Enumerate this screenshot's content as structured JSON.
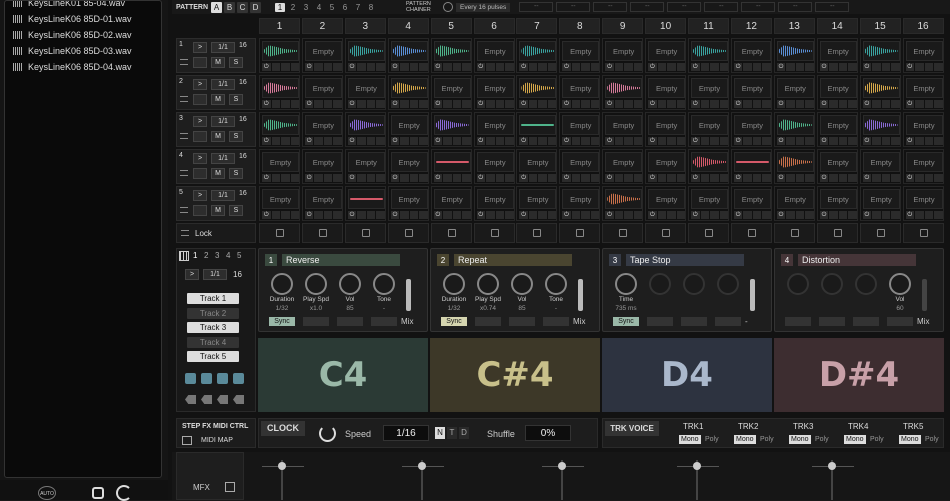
{
  "files": [
    "KeysLineK01 85-04.wav",
    "KeysLineK06 85D-01.wav",
    "KeysLineK06 85D-02.wav",
    "KeysLineK06 85D-03.wav",
    "KeysLineK06 85D-04.wav"
  ],
  "topbar": {
    "pattern_label": "PATTERN",
    "patterns": [
      "A",
      "B",
      "C",
      "D"
    ],
    "numbers": [
      "1",
      "2",
      "3",
      "4",
      "5",
      "6",
      "7",
      "8"
    ],
    "chainer_label": "PATTERN CHAINER",
    "pulses": "Every 16 pulses",
    "dash": "--"
  },
  "columns": [
    "1",
    "2",
    "3",
    "4",
    "5",
    "6",
    "7",
    "8",
    "9",
    "10",
    "11",
    "12",
    "13",
    "14",
    "15",
    "16"
  ],
  "tracks": [
    {
      "num": "1",
      "ratio": "1/1",
      "steps": "16",
      "cells": [
        "green",
        "Empty",
        "teal",
        "blue",
        "green",
        "Empty",
        "teal",
        "Empty",
        "Empty",
        "Empty",
        "teal",
        "Empty",
        "blue",
        "Empty",
        "teal",
        "Empty"
      ]
    },
    {
      "num": "2",
      "ratio": "1/1",
      "steps": "16",
      "cells": [
        "pink",
        "Empty",
        "Empty",
        "gold",
        "Empty",
        "Empty",
        "gold",
        "Empty",
        "pink",
        "Empty",
        "Empty",
        "Empty",
        "Empty",
        "Empty",
        "gold",
        "Empty"
      ]
    },
    {
      "num": "3",
      "ratio": "1/1",
      "steps": "16",
      "cells": [
        "green",
        "Empty",
        "purple",
        "Empty",
        "purple",
        "Empty",
        "gline",
        "Empty",
        "Empty",
        "Empty",
        "Empty",
        "Empty",
        "green",
        "Empty",
        "purple",
        "Empty"
      ]
    },
    {
      "num": "4",
      "ratio": "1/1",
      "steps": "16",
      "cells": [
        "Empty",
        "Empty",
        "Empty",
        "Empty",
        "rline",
        "Empty",
        "Empty",
        "Empty",
        "Empty",
        "Empty",
        "red",
        "rline",
        "orange",
        "Empty",
        "Empty",
        "Empty"
      ]
    },
    {
      "num": "5",
      "ratio": "1/1",
      "steps": "16",
      "cells": [
        "Empty",
        "Empty",
        "rline",
        "Empty",
        "Empty",
        "Empty",
        "Empty",
        "Empty",
        "orange",
        "Empty",
        "Empty",
        "Empty",
        "Empty",
        "Empty",
        "Empty",
        "Empty"
      ]
    }
  ],
  "track_buttons": {
    "m": "M",
    "s": "S",
    "play": ">"
  },
  "empty_label": "Empty",
  "lock_label": "Lock",
  "left_panel": {
    "tabs": [
      "1",
      "2",
      "3",
      "4",
      "5"
    ],
    "ratio": "1/1",
    "steps": "16",
    "tracks": [
      "Track 1",
      "Track 2",
      "Track 3",
      "Track 4",
      "Track 5"
    ],
    "midi_title": "STEP FX MIDI CTRL",
    "midi_map": "MIDI MAP"
  },
  "fx": [
    {
      "num": "1",
      "name": "Reverse",
      "color": "#3a4a3f",
      "knobs": [
        {
          "label": "Duration",
          "val": "1/32"
        },
        {
          "label": "Play Spd",
          "val": "x1.0"
        },
        {
          "label": "Vol",
          "val": "85"
        },
        {
          "label": "Tone",
          "val": "-"
        }
      ],
      "sync": "Sync",
      "mix": "Mix"
    },
    {
      "num": "2",
      "name": "Repeat",
      "color": "#4a4530",
      "knobs": [
        {
          "label": "Duration",
          "val": "1/32"
        },
        {
          "label": "Play Spd",
          "val": "x0.74"
        },
        {
          "label": "Vol",
          "val": "85"
        },
        {
          "label": "Tone",
          "val": "-"
        }
      ],
      "sync": "Sync",
      "mix": "Mix"
    },
    {
      "num": "3",
      "name": "Tape Stop",
      "color": "#353a45",
      "knobs": [
        {
          "label": "Time",
          "val": "735 ms"
        },
        {
          "label": "",
          "val": ""
        },
        {
          "label": "",
          "val": ""
        },
        {
          "label": "",
          "val": ""
        }
      ],
      "sync": "Sync",
      "mix": "-"
    },
    {
      "num": "4",
      "name": "Distortion",
      "color": "#453538",
      "knobs": [
        {
          "label": "",
          "val": ""
        },
        {
          "label": "",
          "val": ""
        },
        {
          "label": "",
          "val": ""
        },
        {
          "label": "Vol",
          "val": "60"
        }
      ],
      "sync": "",
      "mix": "Mix"
    }
  ],
  "pads": [
    "C4",
    "C#4",
    "D4",
    "D#4"
  ],
  "clock": {
    "label": "CLOCK",
    "speed_label": "Speed",
    "speed": "1/16",
    "modes": [
      "N",
      "T",
      "D"
    ],
    "shuffle_label": "Shuffle",
    "shuffle": "0%"
  },
  "voice": {
    "label": "TRK VOICE",
    "tracks": [
      "TRK1",
      "TRK2",
      "TRK3",
      "TRK4",
      "TRK5"
    ],
    "mono": "Mono",
    "poly": "Poly"
  },
  "mfx": "MFX",
  "auto": "AUTO",
  "colors": {
    "green": "#4fb38a",
    "teal": "#3aa3a0",
    "blue": "#5a8fd6",
    "pink": "#d67a9a",
    "gold": "#d6a84a",
    "purple": "#8a6ad6",
    "red": "#d65a6a",
    "orange": "#c9704a"
  }
}
